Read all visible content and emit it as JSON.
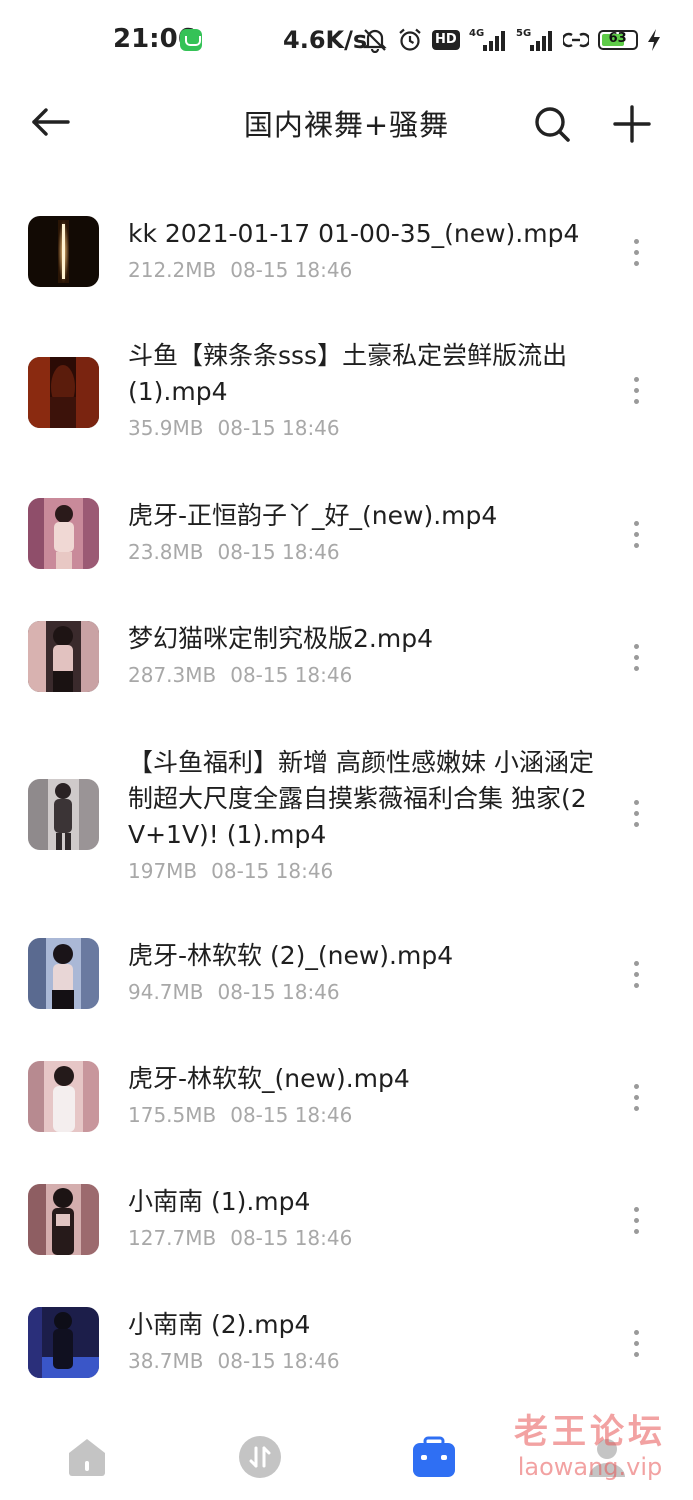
{
  "status_bar": {
    "time": "21:06",
    "net_speed": "4.6K/s",
    "hd_label": "HD",
    "network_1": "4G",
    "network_2": "5G",
    "battery": "63",
    "icons": [
      "muted-bell-icon",
      "alarm-icon",
      "hd-voice-icon",
      "signal-4g-icon",
      "signal-5g-icon",
      "hotspot-link-icon",
      "battery-icon",
      "charging-bolt-icon"
    ]
  },
  "header": {
    "title": "国内裸舞+骚舞",
    "icons": [
      "back-arrow-icon",
      "search-icon",
      "plus-icon"
    ]
  },
  "files": [
    {
      "name": "kk 2021-01-17 01-00-35_(new).mp4",
      "size": "212.2MB",
      "date": "08-15 18:46"
    },
    {
      "name": "斗鱼【辣条条sss】土豪私定尝鲜版流出(1).mp4",
      "size": "35.9MB",
      "date": "08-15 18:46"
    },
    {
      "name": "虎牙-正恒韵子丫_好_(new).mp4",
      "size": "23.8MB",
      "date": "08-15 18:46"
    },
    {
      "name": "梦幻猫咪定制究极版2.mp4",
      "size": "287.3MB",
      "date": "08-15 18:46"
    },
    {
      "name": "【斗鱼福利】新增 高颜性感嫩妹 小涵涵定制超大尺度全露自摸紫薇福利合集  独家(2V+1V)! (1).mp4",
      "size": "197MB",
      "date": "08-15 18:46"
    },
    {
      "name": "虎牙-林软软 (2)_(new).mp4",
      "size": "94.7MB",
      "date": "08-15 18:46"
    },
    {
      "name": "虎牙-林软软_(new).mp4",
      "size": "175.5MB",
      "date": "08-15 18:46"
    },
    {
      "name": "小南南 (1).mp4",
      "size": "127.7MB",
      "date": "08-15 18:46"
    },
    {
      "name": "小南南 (2).mp4",
      "size": "38.7MB",
      "date": "08-15 18:46"
    }
  ],
  "bottom_nav": {
    "items": [
      "home-icon",
      "transfer-icon",
      "toolbox-icon",
      "profile-icon"
    ],
    "active_color": "#2f6ff3",
    "inactive_color": "#c4c4c4"
  },
  "watermark": {
    "line1": "老王论坛",
    "line2": "laowang.vip"
  },
  "colors": {
    "text_primary": "#1f1f1f",
    "text_secondary": "#a8a8a8",
    "accent": "#2f6ff3"
  }
}
